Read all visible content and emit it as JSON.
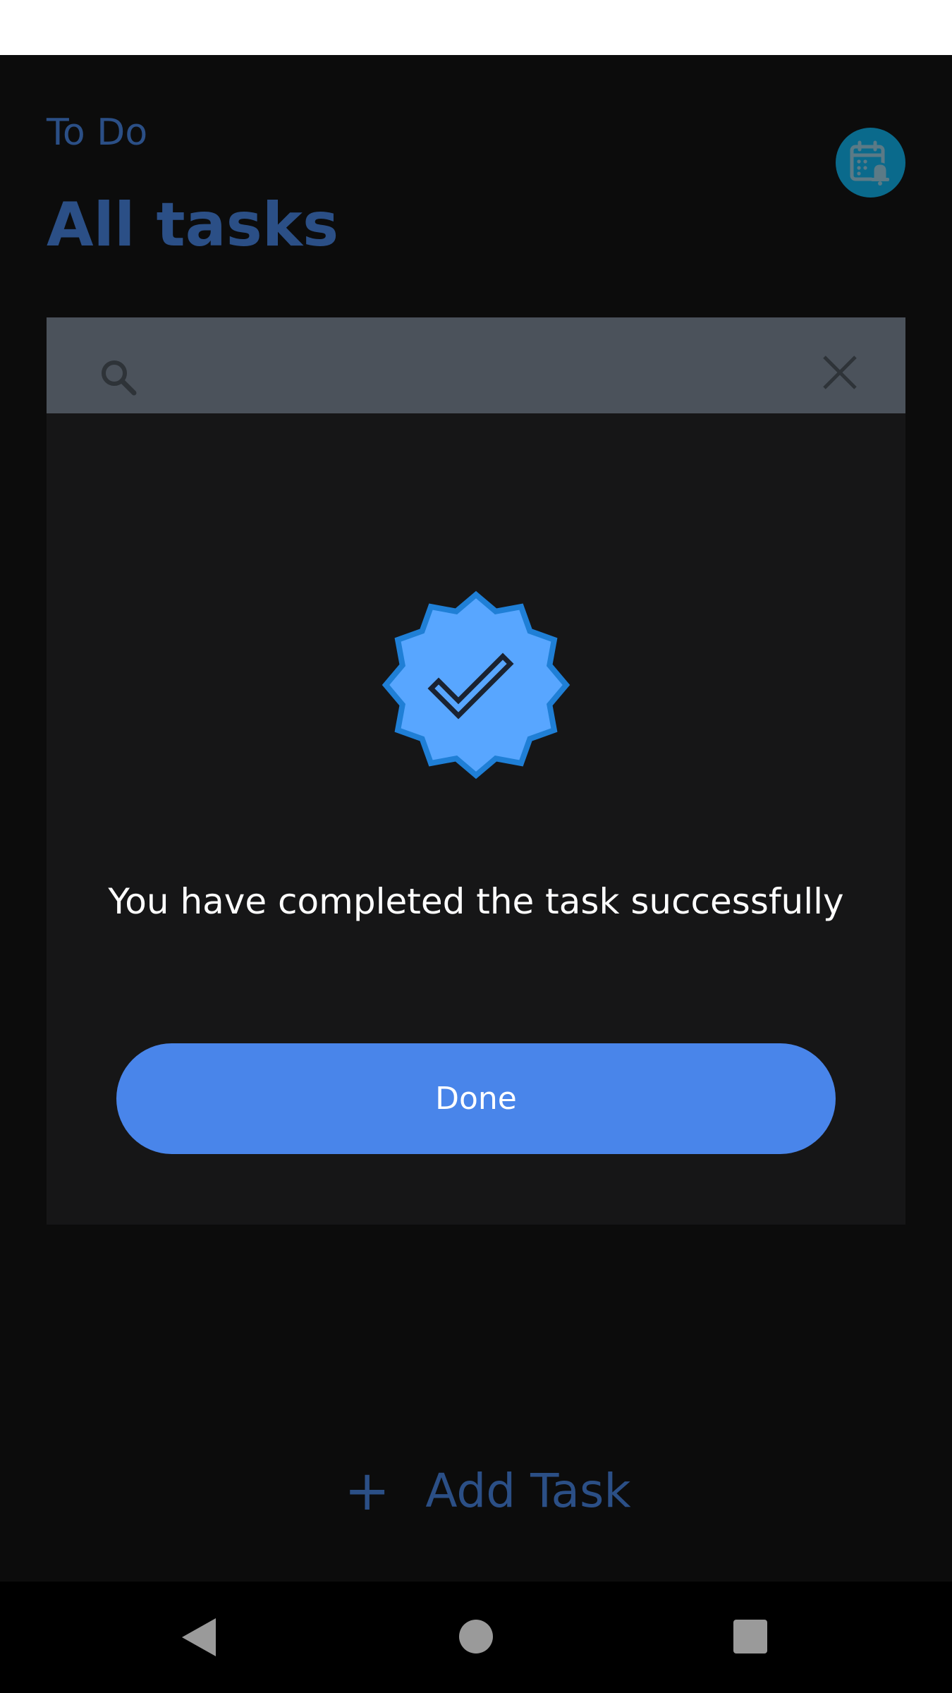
{
  "header": {
    "subtitle": "To Do",
    "title": "All tasks",
    "calendar_icon": "calendar-bell-icon"
  },
  "search": {
    "value": "",
    "placeholder": "",
    "search_icon": "search-icon",
    "clear_icon": "close-icon"
  },
  "dialog": {
    "icon": "verified-badge-icon",
    "message": "You have completed the task successfully",
    "done_label": "Done"
  },
  "footer": {
    "add_task_label": "Add Task",
    "add_icon": "plus-icon"
  },
  "nav": {
    "back_icon": "back-triangle-icon",
    "home_icon": "home-circle-icon",
    "recents_icon": "recents-square-icon"
  },
  "colors": {
    "background": "#0c0c0c",
    "accent_dim": "#2b4f86",
    "button": "#4985ea",
    "badge": "#58a6ff",
    "badge_outline": "#1f7fd6",
    "calendar_button": "#0a6a8c"
  }
}
